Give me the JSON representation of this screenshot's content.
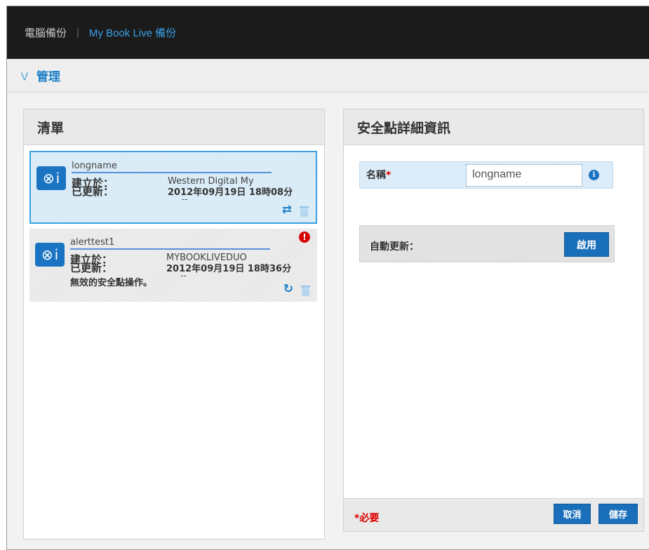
{
  "topbar": {
    "tab_pc_backup": "電腦備份",
    "separator": "|",
    "tab_mybook_backup": "My Book Live 備份"
  },
  "subbar": {
    "title": "管理"
  },
  "list_panel": {
    "title": "清單",
    "items": [
      {
        "name": "longname",
        "label_created": "建立於：",
        "label_updated": "已更新：",
        "created_value": "Western Digital My",
        "updated_value": "2012年09月19日 18時08分",
        "trailing": "--",
        "error_text": "",
        "icon": "backup-device-icon",
        "selected": true
      },
      {
        "name": "alerttest1",
        "label_created": "建立於：",
        "label_updated": "已更新：",
        "created_value": "MYBOOKLIVEDUO",
        "updated_value": "2012年09月19日 18時36分",
        "trailing": "--",
        "error_text": "無效的安全點操作。",
        "icon": "backup-device-icon",
        "selected": false,
        "has_alert": true
      }
    ]
  },
  "details_panel": {
    "title": "安全點詳細資訊",
    "name_label": "名稱",
    "required_star": "*",
    "name_value": "longname",
    "auto_update_label": "自動更新：",
    "enable_button": "啟用",
    "required_note": "*必要",
    "cancel_button": "取消",
    "save_button": "儲存"
  },
  "colors": {
    "accent": "#1a74c2",
    "topbar_bg": "#1b1b1b",
    "selected_bg": "#d5e9f6",
    "alert": "#d60000"
  }
}
